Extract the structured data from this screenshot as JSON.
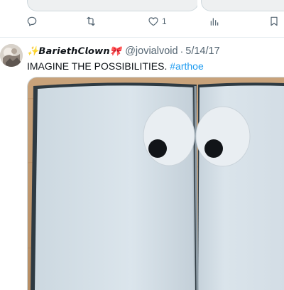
{
  "tweet": {
    "display_name": "✨𝘽𝙖𝙧𝙞𝙚𝙩𝙝𝘾𝙡𝙤𝙬𝙣🎀",
    "handle": "@jovialvoid",
    "separator": "·",
    "date": "5/14/17",
    "text": "IMAGINE THE POSSIBILITIES. ",
    "hashtag": "#arthoe"
  },
  "prev_tweet_actions": {
    "reply_icon": "reply-icon",
    "retweet_icon": "retweet-icon",
    "like_icon": "heart-icon",
    "like_count": "1",
    "analytics_icon": "analytics-icon",
    "bookmark_icon": "bookmark-icon"
  },
  "colors": {
    "accent": "#1d9bf0",
    "secondary_text": "#536471",
    "page_paper": "#dde7ee",
    "eye_white": "#e9eef2",
    "pupil": "#111418"
  }
}
